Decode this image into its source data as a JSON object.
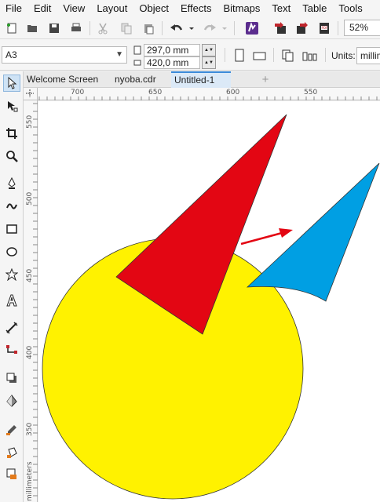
{
  "menu": [
    "File",
    "Edit",
    "View",
    "Layout",
    "Object",
    "Effects",
    "Bitmaps",
    "Text",
    "Table",
    "Tools"
  ],
  "toolbar": {
    "icons": [
      "new-document-icon",
      "open-icon",
      "save-icon",
      "print-icon",
      "cut-icon",
      "copy-icon",
      "paste-icon",
      "undo-icon",
      "redo-icon",
      "search-content-icon",
      "import-icon",
      "export-icon",
      "export-pdf-icon"
    ],
    "zoom": "52%"
  },
  "property_bar": {
    "page_size": "A3",
    "width": "297,0 mm",
    "height": "420,0 mm",
    "units_label": "Units:",
    "units_value": "millimeters"
  },
  "tabs": [
    "Welcome Screen",
    "nyoba.cdr",
    "Untitled-1"
  ],
  "active_tab": "Untitled-1",
  "rulers": {
    "horizontal": [
      "700",
      "650",
      "600",
      "550"
    ],
    "vertical": [
      "550",
      "500",
      "450",
      "400",
      "350"
    ],
    "vertical_unit": "millimeters"
  },
  "tools": [
    "pick-tool",
    "shape-tool",
    "crop-tool",
    "zoom-tool",
    "freehand-tool",
    "artistic-media-tool",
    "rectangle-tool",
    "ellipse-tool",
    "polygon-tool",
    "text-tool",
    "parallel-dimension-tool",
    "connector-tool",
    "drop-shadow-tool",
    "transparency-tool",
    "color-eyedropper-tool",
    "interactive-fill-tool",
    "smart-fill-tool"
  ],
  "colors": {
    "circle_fill": "#fff200",
    "red_triangle": "#e30613",
    "blue_shape": "#009fe3",
    "arrow": "#e30613",
    "accent": "#3b8ad9"
  }
}
